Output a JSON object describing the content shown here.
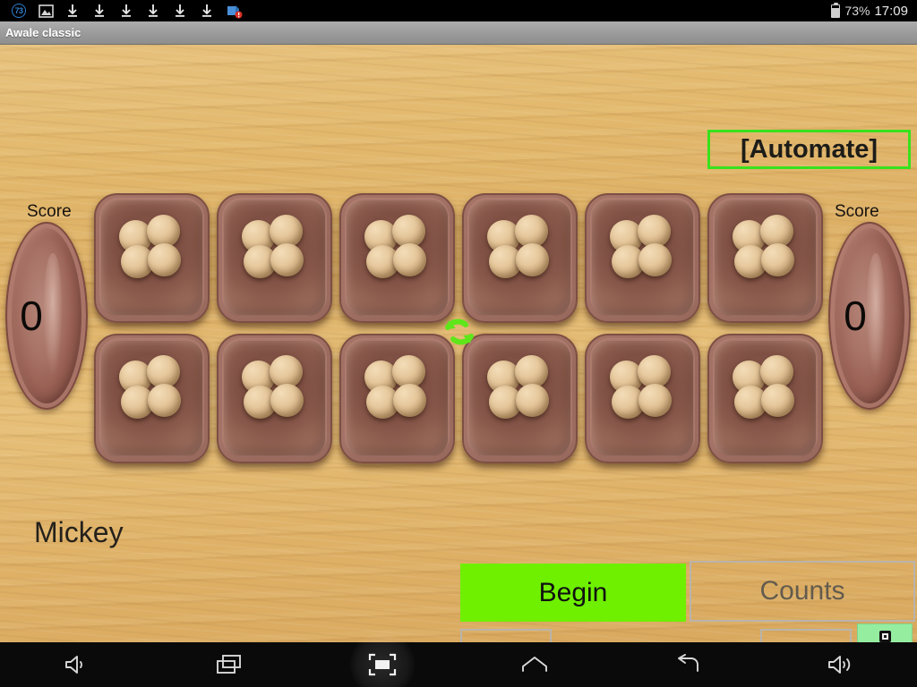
{
  "status_bar": {
    "left_icons": [
      {
        "name": "notification-count-badge",
        "label": "73"
      },
      {
        "name": "screenshot-image-icon",
        "label": ""
      },
      {
        "name": "download-icon",
        "label": ""
      },
      {
        "name": "download-icon",
        "label": ""
      },
      {
        "name": "download-icon",
        "label": ""
      },
      {
        "name": "download-icon",
        "label": ""
      },
      {
        "name": "download-icon",
        "label": ""
      },
      {
        "name": "download-icon",
        "label": ""
      },
      {
        "name": "app-update-alert-icon",
        "label": ""
      }
    ],
    "battery_percent": "73%",
    "clock": "17:09"
  },
  "title_bar": {
    "title": "Awale classic"
  },
  "game": {
    "automate_label": "[Automate]",
    "automate_border_color": "#37e21c",
    "player_name": "Mickey",
    "rotate_icon_color": "#5ee61a",
    "score_left": {
      "label": "Score",
      "value": "0"
    },
    "score_right": {
      "label": "Score",
      "value": "0"
    },
    "board": {
      "rows": 2,
      "columns": 6,
      "top_row_seeds": [
        4,
        4,
        4,
        4,
        4,
        4
      ],
      "bottom_row_seeds": [
        4,
        4,
        4,
        4,
        4,
        4
      ]
    },
    "controls": {
      "begin_label": "Begin",
      "begin_color": "#6ef000",
      "counts_label": "Counts",
      "prev_icon": "arrow-left-icon",
      "next_icon": "arrow-right-icon",
      "menu_icon": "overflow-menu-icon",
      "menu_color": "#95eda0"
    }
  },
  "nav_bar": {
    "buttons": [
      {
        "name": "volume-down-button",
        "icon": "volume-down-icon"
      },
      {
        "name": "recents-button",
        "icon": "recents-icon"
      },
      {
        "name": "screenshot-button",
        "icon": "screenshot-icon",
        "active": true
      },
      {
        "name": "home-button",
        "icon": "home-icon"
      },
      {
        "name": "back-button",
        "icon": "back-icon"
      },
      {
        "name": "volume-up-button",
        "icon": "volume-up-icon"
      }
    ]
  }
}
